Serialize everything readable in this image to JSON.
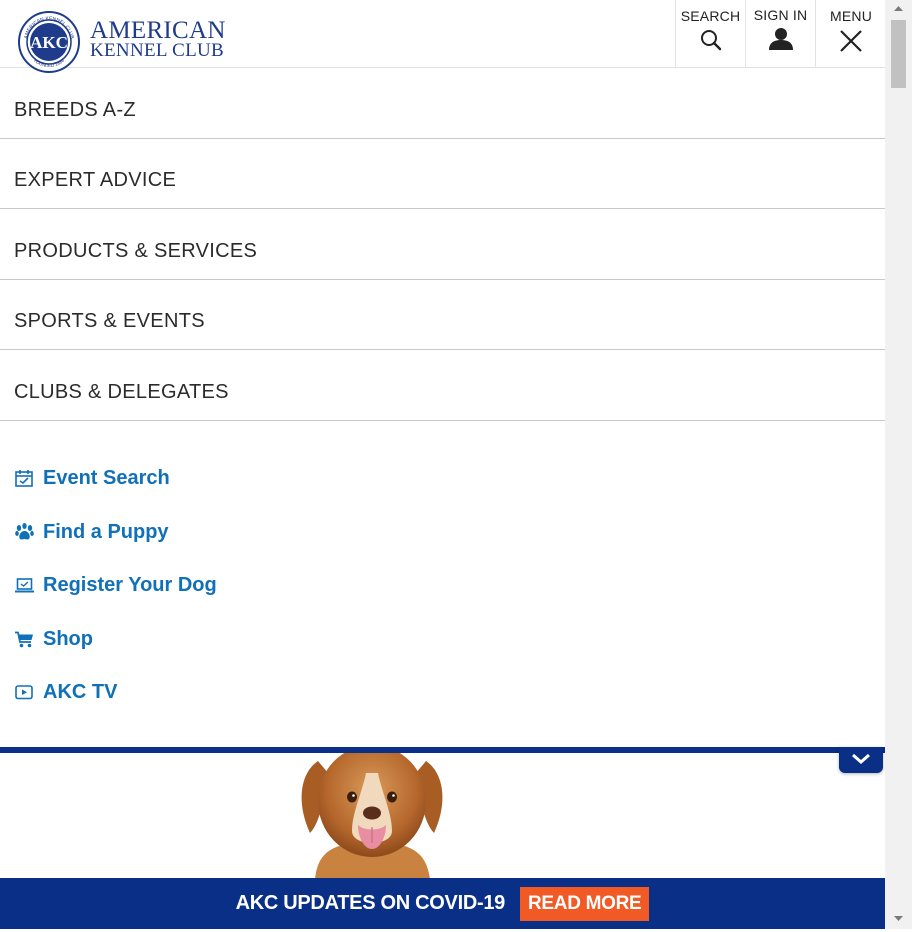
{
  "header": {
    "logo_line1": "AMERICAN",
    "logo_line2": "KENNEL CLUB",
    "seal_text": "AKC",
    "seal_ring_top": "AMERICAN KENNEL CLUB",
    "seal_ring_bottom": "FOUNDED 1884",
    "search_label": "SEARCH",
    "signin_label": "SIGN IN",
    "menu_label": "MENU"
  },
  "nav": {
    "items": [
      {
        "label": "BREEDS A-Z"
      },
      {
        "label": "EXPERT ADVICE"
      },
      {
        "label": "PRODUCTS & SERVICES"
      },
      {
        "label": "SPORTS & EVENTS"
      },
      {
        "label": "CLUBS & DELEGATES"
      }
    ]
  },
  "quick_links": [
    {
      "label": "Event Search",
      "icon": "calendar-icon"
    },
    {
      "label": "Find a Puppy",
      "icon": "paw-icon"
    },
    {
      "label": "Register Your Dog",
      "icon": "laptop-icon"
    },
    {
      "label": "Shop",
      "icon": "cart-icon"
    },
    {
      "label": "AKC TV",
      "icon": "play-icon"
    }
  ],
  "banner": {
    "text": "AKC UPDATES ON COVID-19",
    "button": "READ MORE"
  },
  "colors": {
    "brand_blue": "#0a2f87",
    "link_blue": "#1070b8",
    "accent_orange": "#f15a24",
    "logo_blue": "#1f3c8c"
  }
}
